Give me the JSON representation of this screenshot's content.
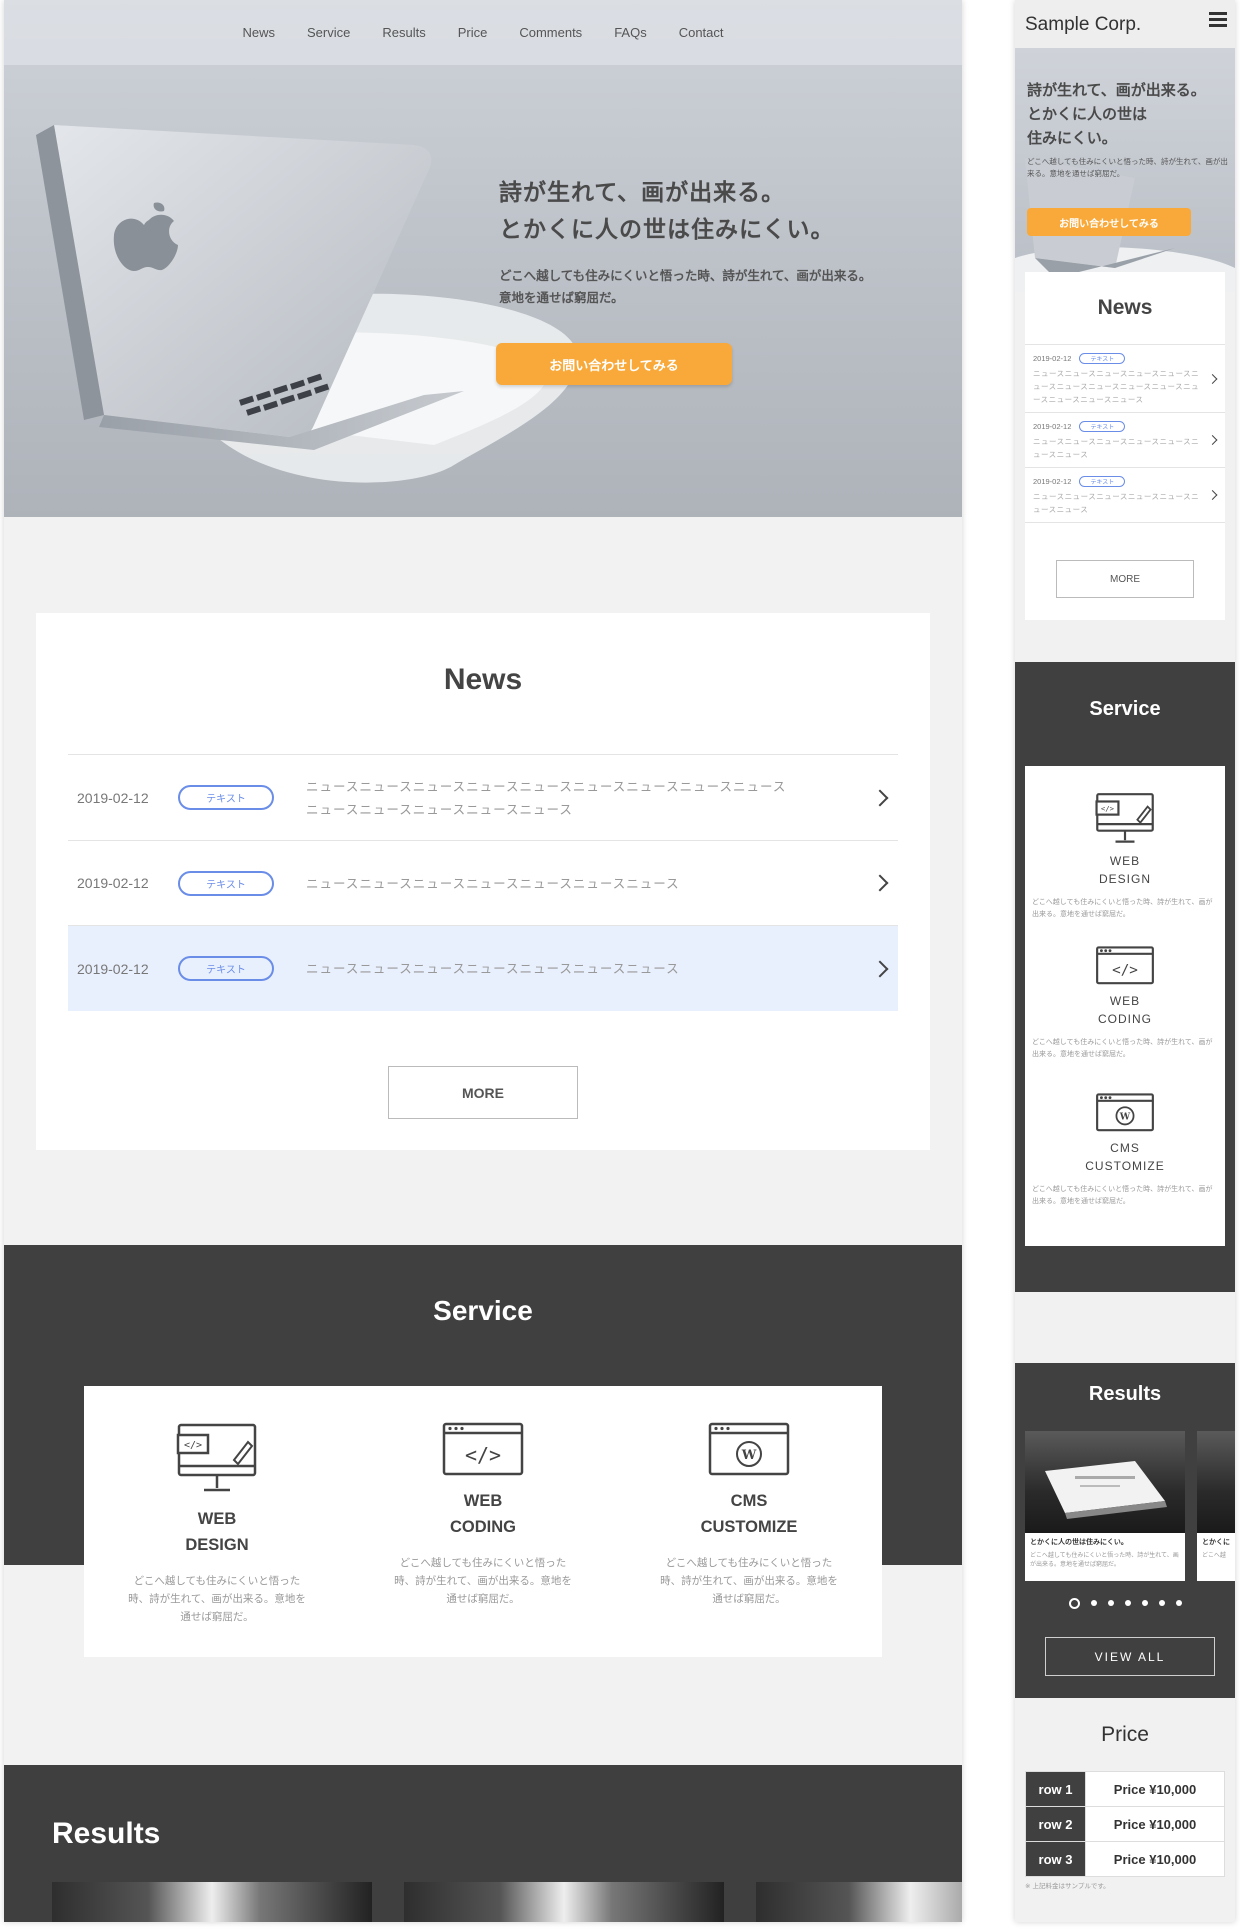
{
  "desktop": {
    "nav": [
      "News",
      "Service",
      "Results",
      "Price",
      "Comments",
      "FAQs",
      "Contact"
    ],
    "hero": {
      "title_line1": "詩が生れて、画が出来る。",
      "title_line2": "とかくに人の世は住みにくい。",
      "text_line1": "どこへ越しても住みにくいと悟った時、詩が生れて、画が出来る。",
      "text_line2": "意地を通せば窮屈だ。",
      "cta": "お問い合わせしてみる"
    },
    "news": {
      "title": "News",
      "items": [
        {
          "date": "2019-02-12",
          "tag": "テキスト",
          "text": "ニュースニュースニュースニュースニュースニュースニュースニュースニュースニュースニュースニュースニュースニュース"
        },
        {
          "date": "2019-02-12",
          "tag": "テキスト",
          "text": "ニュースニュースニュースニュースニュースニュースニュース"
        },
        {
          "date": "2019-02-12",
          "tag": "テキスト",
          "text": "ニュースニュースニュースニュースニュースニュースニュース"
        }
      ],
      "more": "MORE"
    },
    "service": {
      "title": "Service",
      "items": [
        {
          "icon": "monitor-code-icon",
          "name": "WEB\nDESIGN",
          "desc": "どこへ越しても住みにくいと悟った時、詩が生れて、画が出来る。意地を通せば窮屈だ。"
        },
        {
          "icon": "browser-code-icon",
          "name": "WEB\nCODING",
          "desc": "どこへ越しても住みにくいと悟った時、詩が生れて、画が出来る。意地を通せば窮屈だ。"
        },
        {
          "icon": "browser-wordpress-icon",
          "name": "CMS\nCUSTOMIZE",
          "desc": "どこへ越しても住みにくいと悟った時、詩が生れて、画が出来る。意地を通せば窮屈だ。"
        }
      ]
    },
    "results": {
      "title": "Results"
    }
  },
  "mobile": {
    "logo": "Sample Corp.",
    "menu_icon": "hamburger-icon",
    "hero": {
      "title_line1": "詩が生れて、画が出来る。",
      "title_line2": "とかくに人の世は",
      "title_line3": "住みにくい。",
      "text": "どこへ越しても住みにくいと悟った時、詩が生れて、画が出来る。意地を通せば窮屈だ。",
      "cta": "お問い合わせしてみる"
    },
    "news": {
      "title": "News",
      "items": [
        {
          "date": "2019-02-12",
          "tag": "テキスト",
          "text": "ニュースニュースニュースニュースニュースニュースニュースニュースニュースニュースニュースニュースニュースニュース"
        },
        {
          "date": "2019-02-12",
          "tag": "テキスト",
          "text": "ニュースニュースニュースニュースニュースニュースニュース"
        },
        {
          "date": "2019-02-12",
          "tag": "テキスト",
          "text": "ニュースニュースニュースニュースニュースニュースニュース"
        }
      ],
      "more": "MORE"
    },
    "service": {
      "title": "Service",
      "items": [
        {
          "icon": "monitor-code-icon",
          "name": "WEB\nDESIGN",
          "desc": "どこへ越しても住みにくいと悟った時、詩が生れて、画が出来る。意地を通せば窮屈だ。"
        },
        {
          "icon": "browser-code-icon",
          "name": "WEB\nCODING",
          "desc": "どこへ越しても住みにくいと悟った時、詩が生れて、画が出来る。意地を通せば窮屈だ。"
        },
        {
          "icon": "browser-wordpress-icon",
          "name": "CMS\nCUSTOMIZE",
          "desc": "どこへ越しても住みにくいと悟った時、詩が生れて、画が出来る。意地を通せば窮屈だ。"
        }
      ]
    },
    "results": {
      "title": "Results",
      "card_caption": "とかくに人の世は住みにくい。",
      "card_text": "どこへ越しても住みにくいと悟った時、詩が生れて、画が出来る。意地を通せば窮屈だ。",
      "card2_caption": "とかくに",
      "card2_text": "どこへ越",
      "slide_count": 7,
      "active_slide": 1,
      "view_all": "VIEW ALL"
    },
    "price": {
      "title": "Price",
      "rows": [
        {
          "label": "row 1",
          "value": "Price ¥10,000"
        },
        {
          "label": "row 2",
          "value": "Price ¥10,000"
        },
        {
          "label": "row 3",
          "value": "Price ¥10,000"
        }
      ],
      "note": "※ 上記料金はサンプルです。"
    }
  },
  "colors": {
    "accent_orange": "#f8a93a",
    "tag_blue": "#6a8de8",
    "dark_band": "#404040",
    "highlight_row": "#e9f0fd"
  }
}
